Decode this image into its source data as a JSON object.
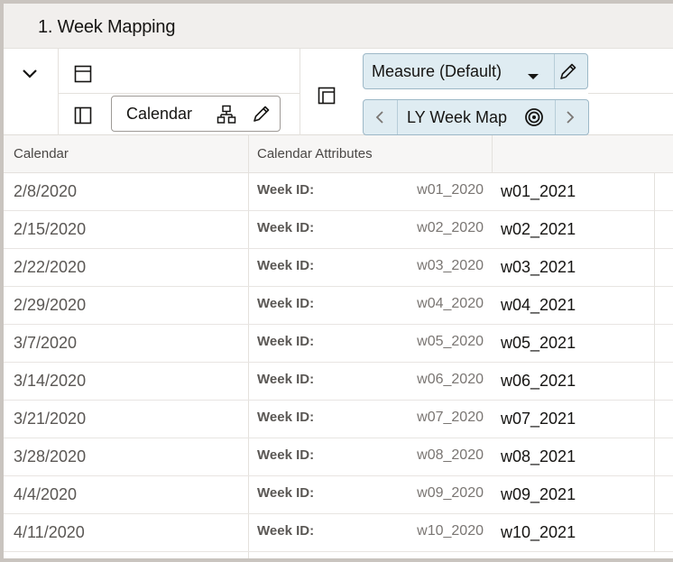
{
  "view": {
    "title": "1. Week Mapping"
  },
  "toolbar": {
    "calendar_button": "Calendar",
    "measure_button": "Measure (Default)",
    "ly_button": "LY Week Map"
  },
  "table": {
    "columns": [
      "Calendar",
      "Calendar Attributes",
      ""
    ],
    "attribute_label": "Week ID:",
    "rows": [
      {
        "date": "2/8/2020",
        "week_id": "w01_2020",
        "ly_map": "w01_2021"
      },
      {
        "date": "2/15/2020",
        "week_id": "w02_2020",
        "ly_map": "w02_2021"
      },
      {
        "date": "2/22/2020",
        "week_id": "w03_2020",
        "ly_map": "w03_2021"
      },
      {
        "date": "2/29/2020",
        "week_id": "w04_2020",
        "ly_map": "w04_2021"
      },
      {
        "date": "3/7/2020",
        "week_id": "w05_2020",
        "ly_map": "w05_2021"
      },
      {
        "date": "3/14/2020",
        "week_id": "w06_2020",
        "ly_map": "w06_2021"
      },
      {
        "date": "3/21/2020",
        "week_id": "w07_2020",
        "ly_map": "w07_2021"
      },
      {
        "date": "3/28/2020",
        "week_id": "w08_2020",
        "ly_map": "w08_2021"
      },
      {
        "date": "4/4/2020",
        "week_id": "w09_2020",
        "ly_map": "w09_2021"
      },
      {
        "date": "4/11/2020",
        "week_id": "w10_2020",
        "ly_map": "w10_2021"
      }
    ]
  },
  "icons": {
    "collapse": "chevron-down-icon",
    "layout_top": "panel-top-icon",
    "layout_left": "panel-left-icon",
    "layout_corner": "layout-corner-icon",
    "hierarchy": "hierarchy-icon",
    "edit": "pencil-icon",
    "dropdown": "caret-down-icon",
    "previous": "chevron-left-icon",
    "next": "chevron-right-icon",
    "target": "target-icon"
  },
  "colors": {
    "title_bar": "#f1efed",
    "accent_button": "#dfecf2",
    "border": "#c9c4bf"
  }
}
